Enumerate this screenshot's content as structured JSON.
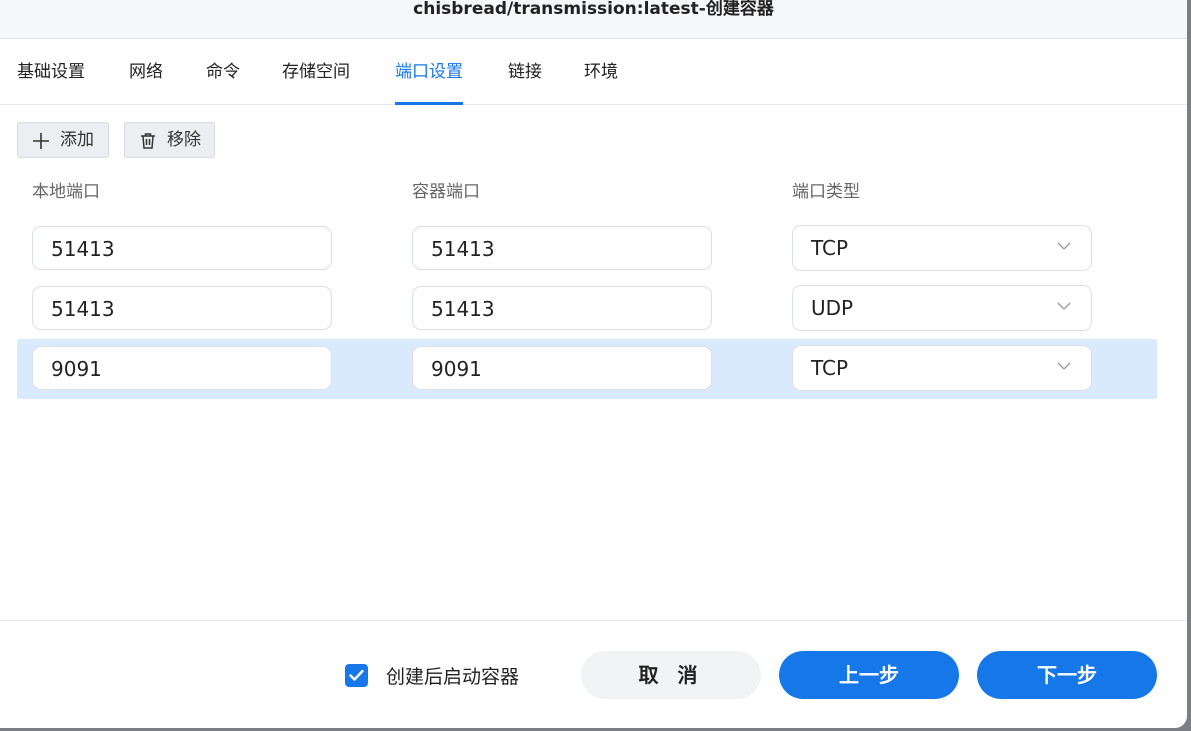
{
  "window": {
    "title": "chisbread/transmission:latest-创建容器"
  },
  "tabs": [
    {
      "label": "基础设置"
    },
    {
      "label": "网络"
    },
    {
      "label": "命令"
    },
    {
      "label": "存储空间"
    },
    {
      "label": "端口设置",
      "active": true
    },
    {
      "label": "链接"
    },
    {
      "label": "环境"
    }
  ],
  "toolbar": {
    "add_label": "添加",
    "remove_label": "移除"
  },
  "table": {
    "headers": [
      "本地端口",
      "容器端口",
      "端口类型"
    ],
    "rows": [
      {
        "local": "51413",
        "container": "51413",
        "type": "TCP"
      },
      {
        "local": "51413",
        "container": "51413",
        "type": "UDP"
      },
      {
        "local": "9091",
        "container": "9091",
        "type": "TCP",
        "selected": true
      }
    ]
  },
  "footer": {
    "start_after_create_label": "创建后启动容器",
    "start_after_create_checked": true,
    "cancel_label": "取 消",
    "prev_label": "上一步",
    "next_label": "下一步"
  },
  "colors": {
    "accent": "#1677e8",
    "selected_row": "#d9eafd"
  },
  "icons": {
    "add": "plus-icon",
    "remove": "trash-icon",
    "dropdown": "chevron-down-icon",
    "checkbox": "check-icon"
  }
}
